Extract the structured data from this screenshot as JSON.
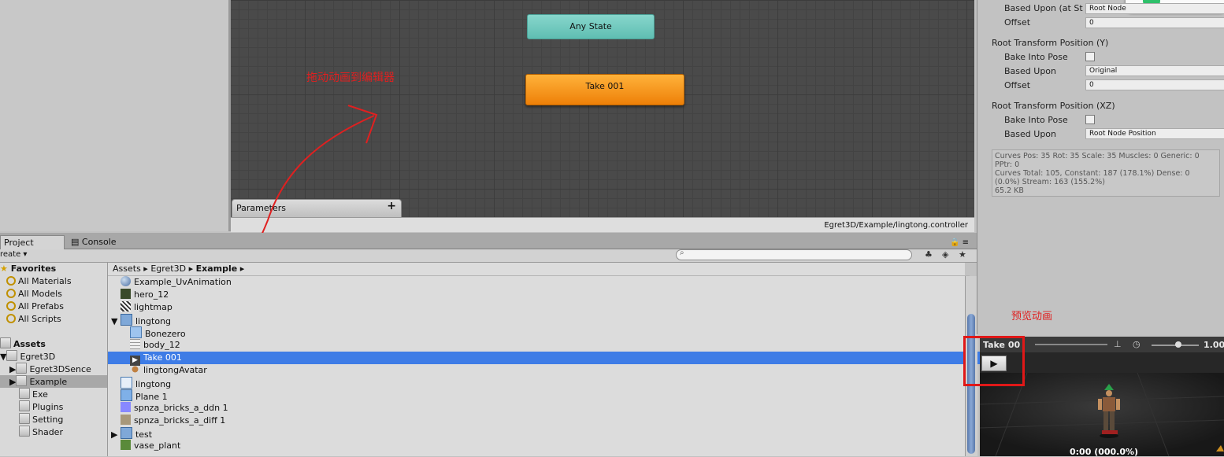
{
  "graph": {
    "any_state": "Any State",
    "take_node": "Take 001",
    "parameters_label": "Parameters",
    "parameters_add": "+",
    "status_path": "Egret3D/Example/lingtong.controller",
    "annotation": "拖动动画到编辑器"
  },
  "project_panel": {
    "tabs": [
      "Project",
      "Console"
    ],
    "create_label": "reate ▾",
    "favorites_title": "Favorites",
    "favorites": [
      "All Materials",
      "All Models",
      "All Prefabs",
      "All Scripts"
    ],
    "assets_title": "Assets",
    "tree": [
      "Egret3D",
      "Egret3DSence",
      "Example",
      "Exe",
      "Plugins",
      "Setting",
      "Shader"
    ],
    "breadcrumb": [
      "Assets",
      "Egret3D",
      "Example"
    ],
    "files": [
      {
        "name": "Example_UvAnimation",
        "icon": "sphere-icon"
      },
      {
        "name": "hero_12",
        "icon": "texture-icon"
      },
      {
        "name": "lightmap",
        "icon": "texture-icon"
      },
      {
        "name": "lingtong",
        "icon": "model-icon"
      },
      {
        "name": "Bonezero",
        "icon": "mesh-icon"
      },
      {
        "name": "body_12",
        "icon": "grid-icon"
      },
      {
        "name": "Take 001",
        "icon": "animation-clip-icon"
      },
      {
        "name": "lingtongAvatar",
        "icon": "avatar-icon"
      },
      {
        "name": "lingtong",
        "icon": "prefab-icon"
      },
      {
        "name": "Plane 1",
        "icon": "cube-icon"
      },
      {
        "name": "spnza_bricks_a_ddn 1",
        "icon": "texture-icon"
      },
      {
        "name": "spnza_bricks_a_diff 1",
        "icon": "texture-icon"
      },
      {
        "name": "test",
        "icon": "model-icon"
      },
      {
        "name": "vase_plant",
        "icon": "texture-icon"
      }
    ],
    "selected_file": "Take 001"
  },
  "inspector": {
    "based_upon_top_label": "Based Upon (at St",
    "based_upon_top_value": "Root Node",
    "offset_label": "Offset",
    "offset_value": "0",
    "section_y": "Root Transform Position (Y)",
    "bake_label": "Bake Into Pose",
    "based_upon_label": "Based Upon",
    "y_based_value": "Original",
    "section_xz": "Root Transform Position (XZ)",
    "xz_based_value": "Root Node Position",
    "stats": [
      "Curves Pos: 35 Rot: 35 Scale: 35 Muscles: 0 Generic: 0",
      "PPtr: 0",
      "Curves Total: 105, Constant: 187 (178.1%) Dense: 0",
      "(0.0%) Stream: 163 (155.2%)",
      "65.2 KB"
    ],
    "notify_text": "0"
  },
  "preview": {
    "annotation": "预览动画",
    "title": "Take 00",
    "speed": "1.00",
    "time": "0:00 (000.0%)",
    "play_glyph": "▶"
  }
}
